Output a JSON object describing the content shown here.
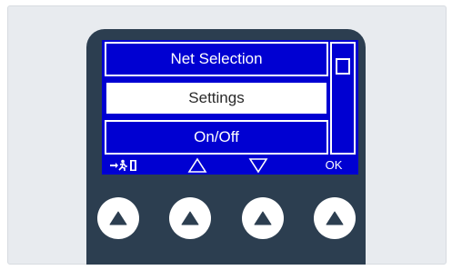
{
  "menu": {
    "items": [
      {
        "label": "Net Selection",
        "selected": false
      },
      {
        "label": "Settings",
        "selected": true
      },
      {
        "label": "On/Off",
        "selected": false
      }
    ]
  },
  "softkeys": {
    "exit_icon": "exit-door-icon",
    "up_icon": "triangle-up-outline-icon",
    "down_icon": "triangle-down-outline-icon",
    "ok_label": "OK"
  },
  "hardware_buttons": {
    "icon": "triangle-up-filled-icon",
    "count": 4
  },
  "colors": {
    "screen_bg": "#0000d2",
    "device_body": "#2c3e50",
    "panel_bg": "#e8ebef",
    "text_light": "#ffffff",
    "text_dark": "#2a2a2a"
  }
}
